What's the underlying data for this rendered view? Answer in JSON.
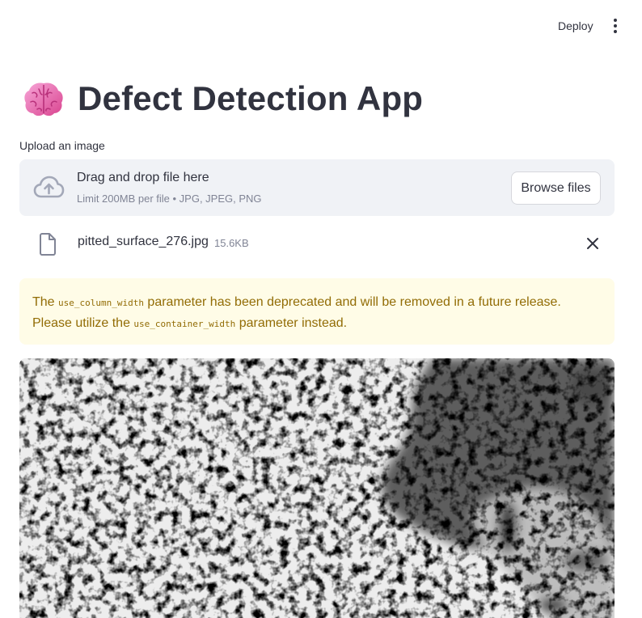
{
  "topbar": {
    "deploy_label": "Deploy",
    "menu_icon": "kebab-menu-icon"
  },
  "header": {
    "emoji_icon": "brain-icon",
    "title": "Defect Detection App"
  },
  "uploader": {
    "label": "Upload an image",
    "drop_title": "Drag and drop file here",
    "drop_subtitle": "Limit 200MB per file • JPG, JPEG, PNG",
    "browse_label": "Browse files",
    "upload_icon": "cloud-upload-icon"
  },
  "uploaded_file": {
    "name": "pitted_surface_276.jpg",
    "size": "15.6KB",
    "file_icon": "file-icon",
    "remove_icon": "close-icon"
  },
  "warning": {
    "text_before": "The ",
    "code_1": "use_column_width",
    "text_middle": " parameter has been deprecated and will be removed in a future release. Please utilize the ",
    "code_2": "use_container_width",
    "text_after": " parameter instead.",
    "background": "#fffce7",
    "text_color": "#926c05"
  },
  "image": {
    "subject": "pitted-surface-image"
  },
  "colors": {
    "text": "#31333f",
    "muted": "#808495",
    "dropzone_bg": "#f0f2f6"
  }
}
